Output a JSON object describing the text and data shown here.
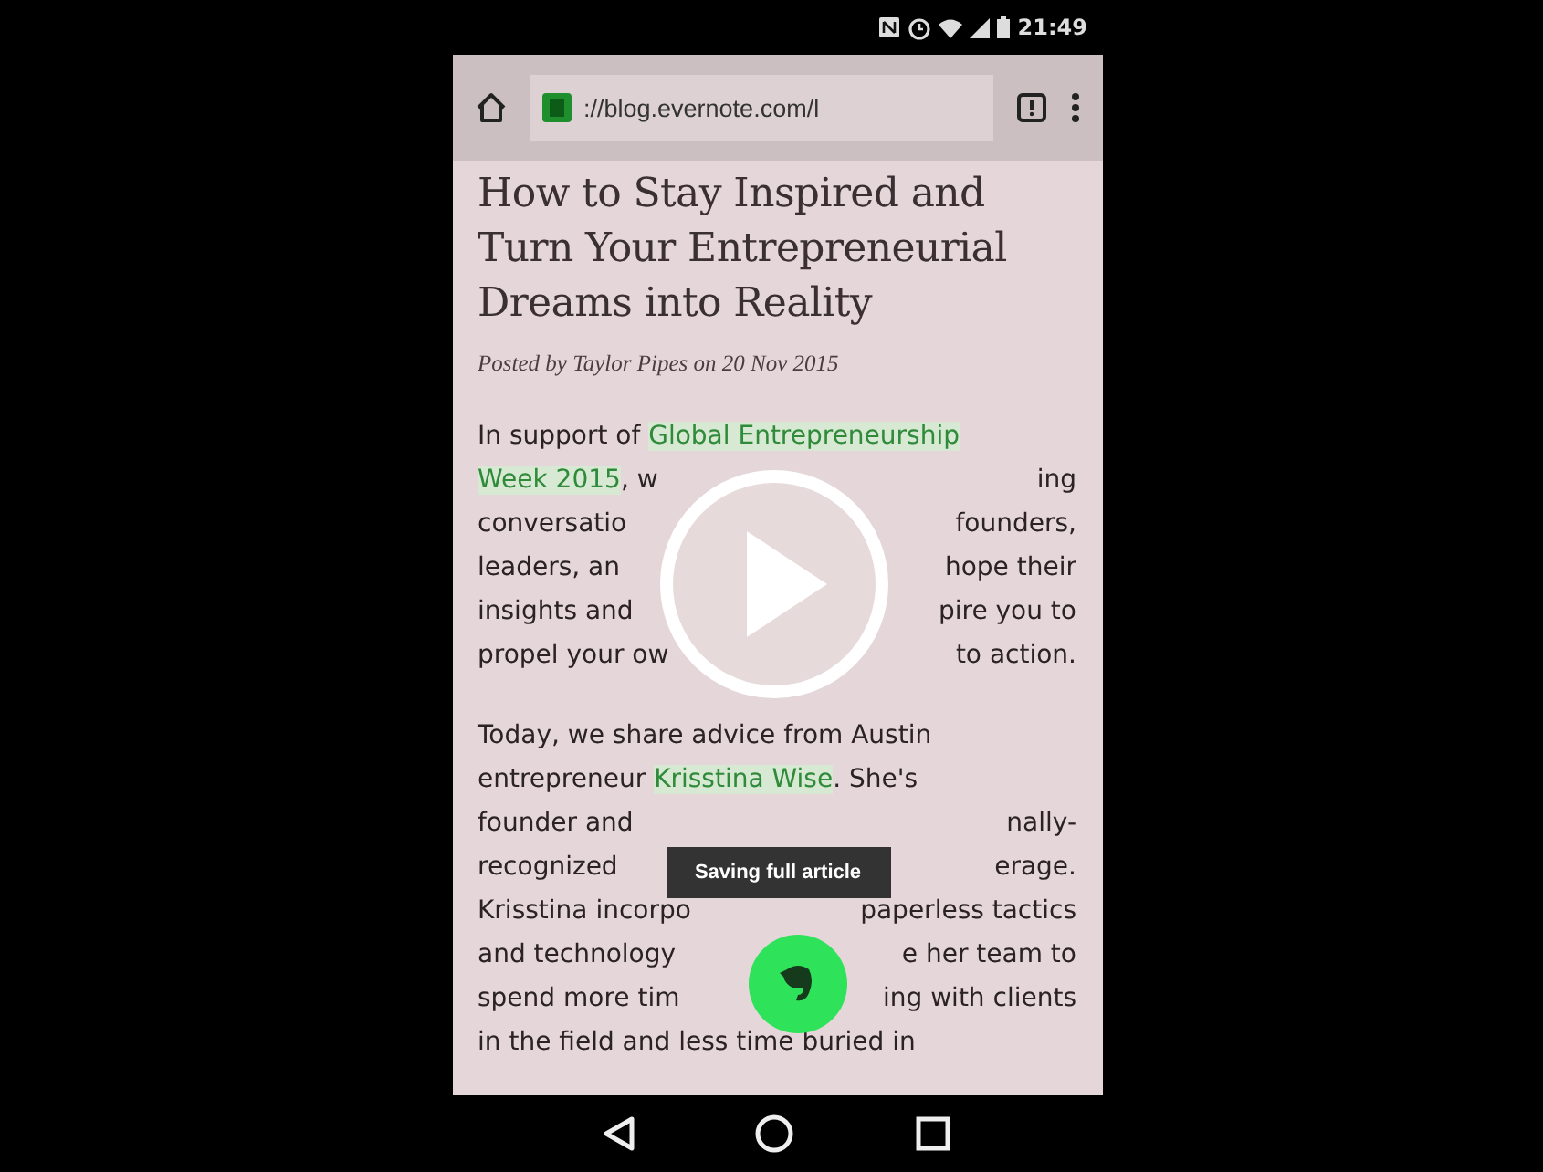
{
  "status_bar": {
    "time": "21:49"
  },
  "toolbar": {
    "url": "://blog.evernote.com/l"
  },
  "article": {
    "title": "How to Stay Inspired and Turn Your Entrepreneurial Dreams into Reality",
    "byline": "Posted by Taylor Pipes on 20 Nov 2015",
    "paragraphs": [
      [
        {
          "left": [
            {
              "text": "In support of ",
              "link": false
            },
            {
              "text": "Global Entrepreneurship",
              "link": true
            }
          ]
        },
        {
          "left": [
            {
              "text": "Week 2015",
              "link": true
            },
            {
              "text": ", w",
              "link": false
            }
          ],
          "right": [
            {
              "text": "ing",
              "link": false
            }
          ]
        },
        {
          "left": [
            {
              "text": "conversatio",
              "link": false
            }
          ],
          "right": [
            {
              "text": "founders,",
              "link": false
            }
          ]
        },
        {
          "left": [
            {
              "text": "leaders, an",
              "link": false
            }
          ],
          "right": [
            {
              "text": "hope their",
              "link": false
            }
          ]
        },
        {
          "left": [
            {
              "text": "insights and",
              "link": false
            }
          ],
          "right": [
            {
              "text": "pire you to",
              "link": false
            }
          ]
        },
        {
          "left": [
            {
              "text": "propel your ow",
              "link": false
            }
          ],
          "right": [
            {
              "text": "to action.",
              "link": false
            }
          ]
        }
      ],
      [
        {
          "left": [
            {
              "text": "Today, we share advice from Austin",
              "link": false
            }
          ]
        },
        {
          "left": [
            {
              "text": "entrepreneur ",
              "link": false
            },
            {
              "text": "Krisstina Wise",
              "link": true
            },
            {
              "text": ". She's",
              "link": false
            }
          ]
        },
        {
          "left": [
            {
              "text": "founder and",
              "link": false
            }
          ],
          "right": [
            {
              "text": "nally-",
              "link": false
            }
          ]
        },
        {
          "left": [
            {
              "text": "recognized",
              "link": false
            }
          ],
          "right": [
            {
              "text": "erage.",
              "link": false
            }
          ]
        },
        {
          "left": [
            {
              "text": "Krisstina incorpo",
              "link": false
            }
          ],
          "right": [
            {
              "text": "paperless tactics",
              "link": false
            }
          ]
        },
        {
          "left": [
            {
              "text": "and technology",
              "link": false
            }
          ],
          "right": [
            {
              "text": "e her team to",
              "link": false
            }
          ]
        },
        {
          "left": [
            {
              "text": "spend more tim",
              "link": false
            }
          ],
          "right": [
            {
              "text": "ing with clients",
              "link": false
            }
          ]
        },
        {
          "left": [
            {
              "text": "in the field and less time buried in",
              "link": false
            }
          ]
        }
      ]
    ]
  },
  "toast": "Saving full article"
}
